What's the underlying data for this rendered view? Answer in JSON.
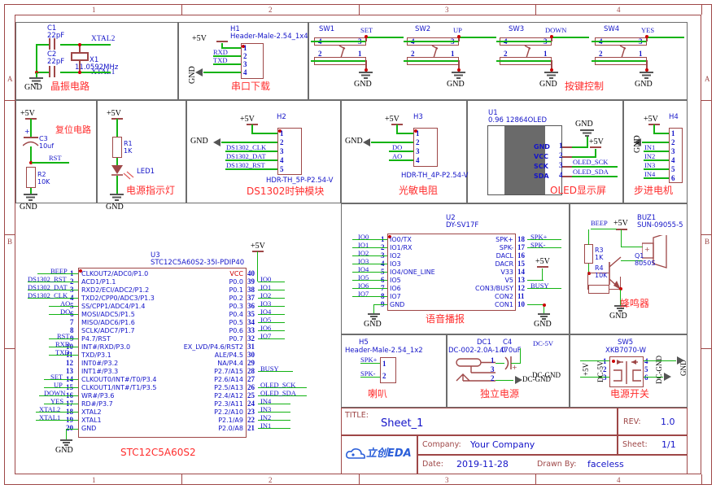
{
  "sheet": {
    "frame_columns": [
      "1",
      "2",
      "3",
      "4"
    ],
    "frame_rows": [
      "A",
      "B"
    ]
  },
  "title_block": {
    "title_key": "TITLE:",
    "title_value": "Sheet_1",
    "rev_key": "REV:",
    "rev_value": "1.0",
    "company_key": "Company:",
    "company_value": "Your Company",
    "sheet_key": "Sheet:",
    "sheet_value": "1/1",
    "date_key": "Date:",
    "date_value": "2019-11-28",
    "drawn_key": "Drawn By:",
    "drawn_value": "faceless",
    "logo_text": "立创EDA"
  },
  "blocks": {
    "crystal": {
      "caption": "晶振电路"
    },
    "serial": {
      "caption": "串口下载"
    },
    "keys": {
      "caption": "按键控制"
    },
    "reset": {
      "caption": "复位电路"
    },
    "powerled": {
      "caption": "电源指示灯"
    },
    "ds1302": {
      "caption": "DS1302时钟模块"
    },
    "photores": {
      "caption": "光敏电阻"
    },
    "oled": {
      "caption": "OLED显示屏"
    },
    "stepper": {
      "caption": "步进电机"
    },
    "voice": {
      "caption": "语音播报"
    },
    "buzzer": {
      "caption": "蜂鸣器"
    },
    "mcu": {
      "caption": "STC12C5A60S2"
    },
    "speaker": {
      "caption": "喇叭"
    },
    "power": {
      "caption": "独立电源"
    },
    "pwrswitch": {
      "caption": "电源开关"
    }
  },
  "crystal": {
    "c1_des": "C1",
    "c1_val": "22pF",
    "c2_des": "C2",
    "c2_val": "22pF",
    "x1_des": "X1",
    "x1_val": "11.0592MHz",
    "net_xtal2": "XTAL2",
    "net_xtal1": "XTAL1",
    "gnd": "GND"
  },
  "serial": {
    "des": "H1",
    "val": "Header-Male-2.54_1x4",
    "power": "+5V",
    "gnd": "GND",
    "nets": [
      "",
      "RXD",
      "TXD",
      ""
    ],
    "pins": [
      "1",
      "2",
      "3",
      "4"
    ]
  },
  "keys": {
    "switches": [
      {
        "des": "SW1",
        "net": "SET",
        "gnd": "GND",
        "pins": [
          "4",
          "3",
          "2",
          "1"
        ]
      },
      {
        "des": "SW2",
        "net": "UP",
        "gnd": "GND",
        "pins": [
          "4",
          "3",
          "2",
          "1"
        ]
      },
      {
        "des": "SW3",
        "net": "DOWN",
        "gnd": "GND",
        "pins": [
          "4",
          "3",
          "2",
          "1"
        ]
      },
      {
        "des": "SW4",
        "net": "YES",
        "gnd": "GND",
        "pins": [
          "4",
          "3",
          "2",
          "1"
        ]
      }
    ]
  },
  "reset": {
    "power": "+5V",
    "gnd": "GND",
    "c3_des": "C3",
    "c3_val": "10uf",
    "r2_des": "R2",
    "r2_val": "10K",
    "net_rst": "RST"
  },
  "powerled": {
    "power": "+5V",
    "gnd": "GND",
    "r1_des": "R1",
    "r1_val": "1K",
    "led_des": "LED1"
  },
  "ds1302": {
    "des": "H2",
    "val": "HDR-TH_5P-P2.54-V",
    "power": "+5V",
    "gnd": "GND",
    "pins": [
      "1",
      "2",
      "3",
      "4",
      "5"
    ],
    "nets": [
      "",
      "",
      "DS1302_CLK",
      "DS1302_DAT",
      "DS1302_RST"
    ]
  },
  "photores": {
    "des": "H3",
    "val": "HDR-TH_4P-P2.54-V",
    "power": "+5V",
    "gnd": "GND",
    "pins": [
      "1",
      "2",
      "3",
      "4"
    ],
    "nets": [
      "",
      "",
      "DO",
      "AO"
    ]
  },
  "oled": {
    "des": "U1",
    "val": "0.96 12864OLED",
    "gnd": "GND",
    "power": "+5V",
    "pins": [
      "1",
      "2",
      "3",
      "4"
    ],
    "pin_names": [
      "GND",
      "VCC",
      "SCK",
      "SDA"
    ],
    "nets": [
      "",
      "",
      "OLED_SCK",
      "OLED_SDA"
    ]
  },
  "stepper": {
    "des": "H4",
    "power": "+5V",
    "gnd": "GND",
    "pins": [
      "1",
      "2",
      "3",
      "4",
      "5",
      "6"
    ],
    "nets": [
      "",
      "",
      "IN1",
      "IN2",
      "IN3",
      "IN4"
    ]
  },
  "voice": {
    "des": "U2",
    "val": "DY-SV17F",
    "power": "+5V",
    "gnd": "GND",
    "left_pins": [
      "1",
      "2",
      "3",
      "4",
      "5",
      "6",
      "7",
      "8",
      "9"
    ],
    "left_names": [
      "IO0/TX",
      "IO1/RX",
      "IO2",
      "IO3",
      "IO4/ONE_LINE",
      "IO5",
      "IO6",
      "IO7",
      "GND"
    ],
    "left_nets": [
      "IO0",
      "IO1",
      "IO2",
      "IO3",
      "IO4",
      "IO5",
      "IO6",
      "IO7",
      ""
    ],
    "right_pins": [
      "18",
      "17",
      "16",
      "15",
      "14",
      "13",
      "12",
      "11",
      "10"
    ],
    "right_names": [
      "SPK+",
      "SPK-",
      "DACL",
      "DACR",
      "V33",
      "V5",
      "CON3/BUSY",
      "CON2",
      "CON1"
    ],
    "right_nets": [
      "SPK+",
      "SPK-",
      "",
      "",
      "",
      "",
      "BUSY",
      "",
      ""
    ]
  },
  "buzzer": {
    "des": "BUZ1",
    "val": "SUN-09055-5",
    "power": "+5V",
    "gnd": "GND",
    "net_beep": "BEEP",
    "r3_des": "R3",
    "r3_val": "1K",
    "r4_des": "R4",
    "r4_val": "10K",
    "q1_des": "Q1",
    "q1_val": "8050S"
  },
  "mcu": {
    "des": "U3",
    "val": "STC12C5A60S2-35I-PDIP40",
    "power": "+5V",
    "gnd": "GND",
    "vcc_label": "VCC",
    "left_pins": [
      "1",
      "2",
      "3",
      "4",
      "5",
      "6",
      "7",
      "8",
      "9",
      "10",
      "11",
      "12",
      "13",
      "14",
      "15",
      "16",
      "17",
      "18",
      "19",
      "20"
    ],
    "left_names": [
      "CLKOUT2/ADC0/P1.0",
      "ACD1/P1.1",
      "RXD2/ECI/ADC2/P1.2",
      "TXD2/CPP0/ADC3/P1.3",
      "SS/CPP1/ADC4/P1.4",
      "MOSI/ADC5/P1.5",
      "MISO/ADC6/P1.6",
      "SCLK/ADC7/P1.7",
      "P4.7/RST",
      "INT#/RXD/P3.0",
      "TXD/P3.1",
      "INT0#/P3.2",
      "INT1#/P3.3",
      "CLKOUT0/INT#/T0/P3.4",
      "CLKOUT1/INT#/T1/P3.5",
      "WR#/P3.6",
      "RD#/P3.7",
      "XTAL2",
      "XTAL1",
      "GND"
    ],
    "left_nets": [
      "BEEP",
      "DS1302_RST",
      "DS1302_DAT",
      "DS1302_CLK",
      "AO",
      "DO",
      "",
      "",
      "RST",
      "RXD",
      "TXD",
      "",
      "",
      "SET",
      "UP",
      "DOWN",
      "YES",
      "XTAL2",
      "XTAL1",
      ""
    ],
    "right_pins": [
      "40",
      "39",
      "38",
      "37",
      "36",
      "35",
      "34",
      "33",
      "32",
      "31",
      "30",
      "29",
      "28",
      "27",
      "26",
      "25",
      "24",
      "23",
      "22",
      "21"
    ],
    "right_names": [
      "VCC",
      "P0.0",
      "P0.1",
      "P0.2",
      "P0.3",
      "P0.4",
      "P0.5",
      "P0.6",
      "P0.7",
      "EX_LVD/P4.6/RST2",
      "ALE/P4.5",
      "NA/P4.4",
      "P2.7/A15",
      "P2.6/A14",
      "P2.5/A13",
      "P2.4/A12",
      "P2.3/A11",
      "P2.2/A10",
      "P2.1/A9",
      "P2.0/A8"
    ],
    "right_nets": [
      "",
      "IO0",
      "IO1",
      "IO2",
      "IO3",
      "IO4",
      "IO5",
      "IO6",
      "IO7",
      "",
      "",
      "",
      "BUSY",
      "",
      "OLED_SCK",
      "OLED_SDA",
      "IN4",
      "IN3",
      "IN2",
      "IN1"
    ]
  },
  "speaker": {
    "des": "H5",
    "val": "Header-Male-2.54_1x2",
    "pins": [
      "1",
      "2"
    ],
    "nets": [
      "SPK+",
      "SPK-"
    ]
  },
  "power": {
    "des": "DC1",
    "val": "DC-002-2.0A-1.0",
    "c4_des": "C4",
    "c4_val": "470uF",
    "pins": [
      "1",
      "3",
      "2"
    ],
    "net_dc5v": "DC-5V",
    "net_dcgnd": "DC-GND"
  },
  "pwrswitch": {
    "des": "SW5",
    "val": "XKB7070-W",
    "pins": [
      "1",
      "2",
      "3",
      "4",
      "5",
      "6"
    ],
    "net_5v": "+5V",
    "net_dc5v": "DC-5V",
    "net_dcgnd": "DC-GND",
    "net_gnd": "GND"
  }
}
